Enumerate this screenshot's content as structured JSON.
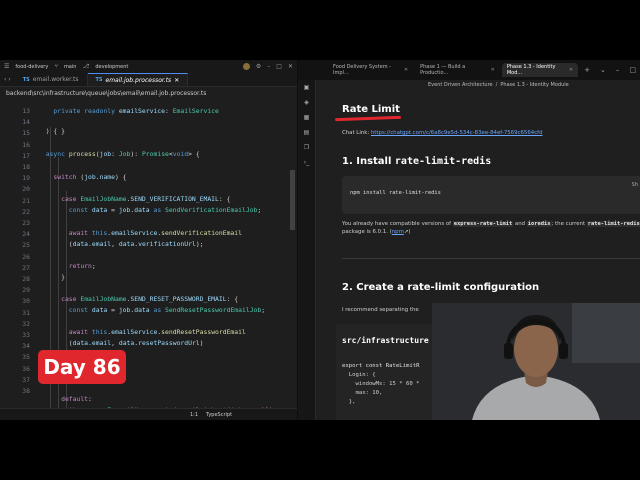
{
  "editor": {
    "title_items": [
      "food-delivery",
      "main",
      "development"
    ],
    "tabs": [
      {
        "label": "email.worker.ts",
        "active": false
      },
      {
        "label": "email.job.processor.ts",
        "active": true
      }
    ],
    "breadcrumb": "backend\\src\\infrastructure\\queue\\jobs\\email\\email.job.processor.ts",
    "line_numbers": [
      "13",
      "14",
      "15",
      "16",
      "17",
      "18",
      "19",
      "20",
      "21",
      "22",
      "23",
      "24",
      "25",
      "26",
      "27",
      "28",
      "29",
      "30",
      "31",
      "32",
      "33",
      "34",
      "35",
      "36",
      "37",
      "38"
    ],
    "status": {
      "position": "1:1",
      "language": "TypeScript"
    }
  },
  "badge": {
    "text": "Day 86"
  },
  "browser": {
    "tabs": [
      {
        "label": "Food Delivery System - Impl...",
        "active": false
      },
      {
        "label": "Phase 1 — Build a Productio...",
        "active": false
      },
      {
        "label": "Phase 1.3 - Identity Mod...",
        "active": true
      }
    ],
    "breadcrumb": [
      "Event Driven Architecture",
      "/",
      "Phase 1.3 - Identity Module"
    ],
    "doc": {
      "heading": "Rate Limit",
      "chat_label": "Chat Link:",
      "chat_url": "https://chatgpt.com/c/6a8c9e5d-534c-83ee-84ef-7569c6564cfd",
      "section1_prefix": "1. Install",
      "section1_code": "rate-limit-redis",
      "install_cmd": "npm install rate-limit-redis",
      "copy_hint": "Sh",
      "para_1": "You already have compatible versions of",
      "code_a": "express-rate-limit",
      "para_and": "and",
      "code_b": "ioredis",
      "para_2": "; the current",
      "code_c": "rate-limit-redis",
      "para_3": "package is 6.0.1. (",
      "npm_link": "npm",
      "para_4": ")",
      "section2": "2. Create a rate-limit configuration",
      "recommend": "I recommend separating the",
      "path_heading": "src/infrastructure",
      "cfg_lines": [
        "export const RateLimitR",
        "  Login: {",
        "    windowMs: 15 * 60 *",
        "    max: 10,",
        "  },"
      ]
    }
  },
  "colors": {
    "badge": "#e0272d",
    "editor_bg": "#1e1e1e",
    "doc_bg": "#1f1f1f",
    "link": "#6aa6ff"
  }
}
